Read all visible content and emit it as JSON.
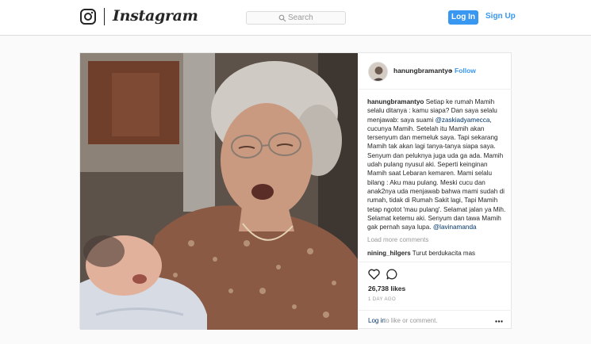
{
  "header": {
    "brand": "Instagram",
    "search_placeholder": "Search",
    "login_label": "Log In",
    "signup_label": "Sign Up"
  },
  "post": {
    "author": "hanungbramantyo",
    "dot": "•",
    "follow_label": "Follow",
    "caption": {
      "user": "hanungbramantyo",
      "text_1": " Setiap ke rumah Mamih selalu ditanya : kamu siapa? Dan saya selalu menjawab: saya suami ",
      "mention_1": "@zaskiadyamecca",
      "text_2": ", cucunya Mamih. Setelah itu Mamih akan tersenyum dan memeluk saya. Tapi sekarang Mamih tak akan lagi tanya-tanya siapa saya. Senyum dan peluknya juga uda ga ada. Mamih udah pulang nyusul aki. Seperti keinginan Mamih saat Lebaran kemaren. Mami selalu bilang : Aku mau pulang. Meski cucu dan anak2nya uda menjawab bahwa mami sudah di rumah, tidak di Rumah Sakit lagi, Tapi Mamih tetap ngotot 'mau pulang'. Selamat jalan ya Mih. Selamat ketemu aki. Senyum dan tawa Mamih gak pernah saya lupa. ",
      "mention_2": "@lavinamanda"
    },
    "load_more": "Load more comments",
    "comment": {
      "user": "nining_hilgers",
      "text": " Turut berdukacita mas"
    },
    "likes": "26,738 likes",
    "time_ago": "1 DAY AGO",
    "login_link": "Log in",
    "login_rest": " to like or comment."
  },
  "colors": {
    "accent": "#3897f0",
    "text": "#262626",
    "muted": "#999999",
    "link_dark": "#003569"
  },
  "icons": [
    "instagram-glyph-icon",
    "search-icon",
    "heart-icon",
    "comment-icon",
    "more-options-icon"
  ]
}
